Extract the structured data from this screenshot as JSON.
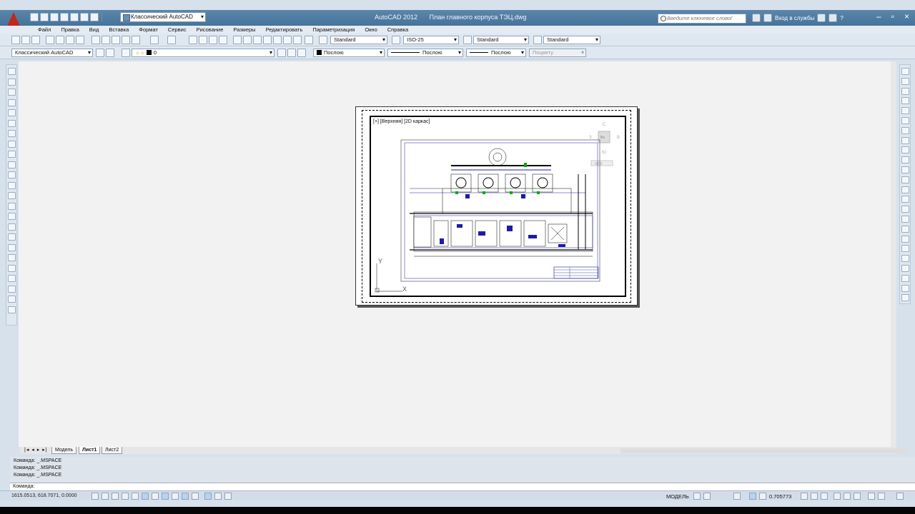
{
  "window": {
    "app_name": "AutoCAD 2012",
    "document_name": "План главного корпуса ТЭЦ.dwg",
    "workspace": "Классический AutoCAD",
    "search_placeholder": "Введите ключевое слово/фразу",
    "signin_label": "Вход в службы",
    "help_label": "?"
  },
  "menu": [
    "Файл",
    "Правка",
    "Вид",
    "Вставка",
    "Формат",
    "Сервис",
    "Рисование",
    "Размеры",
    "Редактировать",
    "Параметризация",
    "Окно",
    "Справка"
  ],
  "styles_toolbar": {
    "text_style": "Standard",
    "dim_style": "ISO-25",
    "table_style": "Standard",
    "mleader_style": "Standard"
  },
  "layers_toolbar": {
    "workspace": "Классический AutoCAD",
    "layer": "0",
    "color": "Послою",
    "linetype": "Послою",
    "lineweight": "Послою",
    "plotstyle": "Поцвету"
  },
  "viewport": {
    "label": "[+] [Верхняя] [2D каркас]",
    "ucs_x": "X",
    "ucs_y": "Y",
    "cube_top": "С",
    "cube_right": "В",
    "cube_left": "З",
    "cube_face": "Ве",
    "cube_bottom": "Ю",
    "mck_label": "МСК"
  },
  "tabs": {
    "model": "Модель",
    "sheet1": "Лист1",
    "sheet2": "Лист2",
    "active": "Лист1"
  },
  "command": {
    "history": [
      "Команда: _.MSPACE",
      "Команда: _.MSPACE",
      "Команда: _.MSPACE"
    ],
    "prompt": "Команда:"
  },
  "status": {
    "coordinates": "1615.0513, 618.7071, 0.0000",
    "space": "МОДЕЛЬ",
    "scale": "0.705773"
  },
  "colors": {
    "titlebar": "#4f7ca3",
    "canvas": "#f2f2f2",
    "drawing_lines": "#1c1ca8"
  }
}
